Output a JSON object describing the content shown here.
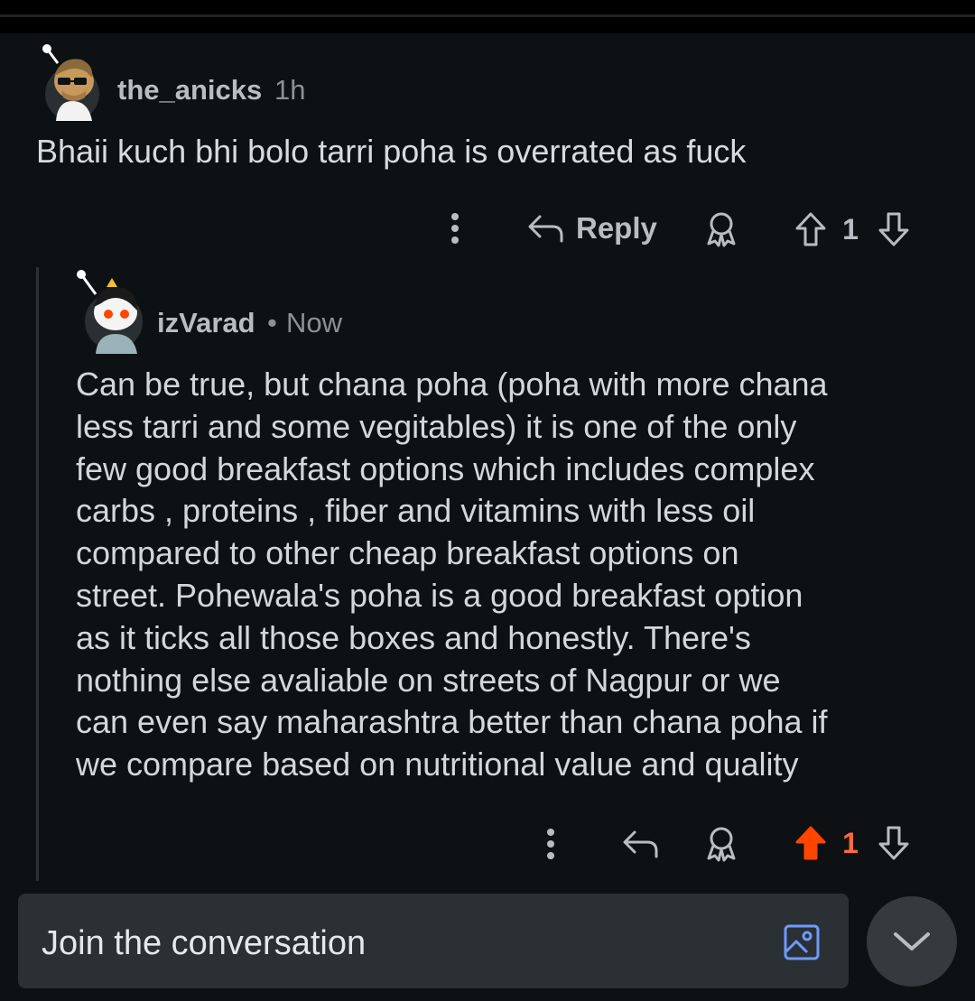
{
  "comments": [
    {
      "username": "the_anicks",
      "time": "1h",
      "text": "Bhaii kuch bhi bolo tarri poha is overrated as fuck",
      "reply_label": "Reply",
      "vote_count": "1"
    },
    {
      "username": "izVarad",
      "separator": "•",
      "time": "Now",
      "lines": [
        "Can be true, but chana poha (poha with more chana",
        "less tarri and some vegitables) it is one of the only",
        "few good breakfast options which includes complex",
        "carbs , proteins , fiber and vitamins with less oil",
        "compared to other cheap breakfast options on",
        "street. Pohewala's poha is a good breakfast option",
        "as it ticks all those boxes and honestly. There's",
        "nothing else avaliable on streets of Nagpur or we",
        "can even say maharashtra better than chana poha if",
        "we compare based on nutritional value and quality"
      ],
      "vote_count": "1"
    }
  ],
  "composer": {
    "placeholder": "Join the conversation"
  },
  "colors": {
    "background": "#0e1113",
    "upvote_active": "#ff4500",
    "composer_bg": "#2a3034"
  }
}
